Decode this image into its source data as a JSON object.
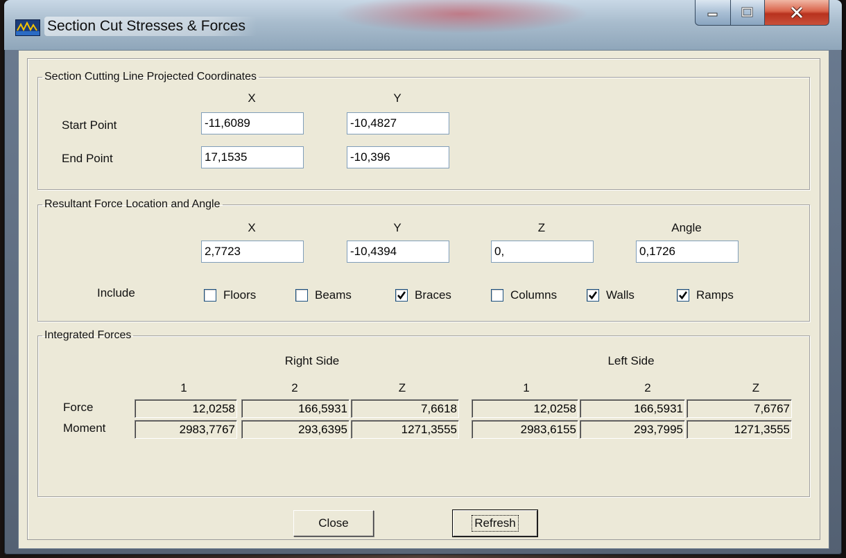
{
  "window": {
    "title": "Section Cut Stresses & Forces"
  },
  "section_cut": {
    "legend": "Section Cutting Line Projected Coordinates",
    "col_x": "X",
    "col_y": "Y",
    "start_label": "Start Point",
    "end_label": "End Point",
    "start_x": "-11,6089",
    "start_y": "-10,4827",
    "end_x": "17,1535",
    "end_y": "-10,396"
  },
  "resultant": {
    "legend": "Resultant Force Location and Angle",
    "col_x": "X",
    "col_y": "Y",
    "col_z": "Z",
    "col_angle": "Angle",
    "x": "2,7723",
    "y": "-10,4394",
    "z": "0,",
    "angle": "0,1726",
    "include_label": "Include",
    "options": [
      {
        "label": "Floors",
        "checked": false
      },
      {
        "label": "Beams",
        "checked": false
      },
      {
        "label": "Braces",
        "checked": true
      },
      {
        "label": "Columns",
        "checked": false
      },
      {
        "label": "Walls",
        "checked": true
      },
      {
        "label": "Ramps",
        "checked": true
      }
    ]
  },
  "integrated": {
    "legend": "Integrated Forces",
    "right_side": "Right Side",
    "left_side": "Left Side",
    "cols": [
      "1",
      "2",
      "Z"
    ],
    "force_label": "Force",
    "moment_label": "Moment",
    "right_force": [
      "12,0258",
      "166,5931",
      "7,6618"
    ],
    "right_moment": [
      "2983,7767",
      "293,6395",
      "1271,3555"
    ],
    "left_force": [
      "12,0258",
      "166,5931",
      "7,6767"
    ],
    "left_moment": [
      "2983,6155",
      "293,7995",
      "1271,3555"
    ]
  },
  "buttons": {
    "close": "Close",
    "refresh": "Refresh"
  }
}
